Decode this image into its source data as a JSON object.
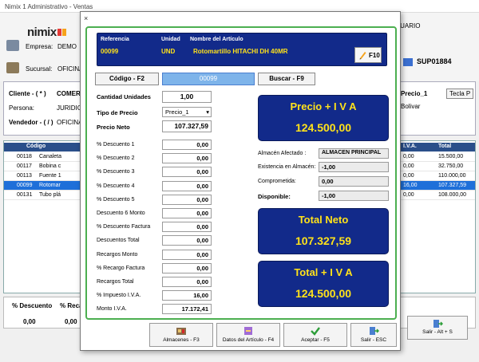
{
  "window": {
    "title": "Nimix 1 Administrativo - Ventas",
    "user_label": "USUARIO"
  },
  "background": {
    "logo": "nimix",
    "empresa_label": "Empresa:",
    "empresa_value": "DEMO",
    "sucursal_label": "Sucursal:",
    "sucursal_value": "OFICINA",
    "doc_number": "SUP01884",
    "cliente_label": "Cliente - ( * )",
    "cliente_value": "COMERCI",
    "persona_label": "Persona:",
    "persona_value": "JURIDICA",
    "vendedor_label": "Vendedor - ( / )",
    "vendedor_value": "OFICINA",
    "precio_label": "Precio_1",
    "tecla_label": "Tecla P",
    "city": "Bolivar",
    "grid_headers": [
      "Código",
      "I.V.A.",
      "Total"
    ],
    "grid_rows": [
      {
        "code": "00118",
        "desc": "Canaleta",
        "iva": "0,00",
        "total": "15.500,00",
        "selected": false
      },
      {
        "code": "00117",
        "desc": "Bobina c",
        "iva": "0,00",
        "total": "32.750,00",
        "selected": false
      },
      {
        "code": "00113",
        "desc": "Fuente 1",
        "iva": "0,00",
        "total": "110.000,00",
        "selected": false
      },
      {
        "code": "00099",
        "desc": "Rotomar",
        "iva": "16,00",
        "total": "107.327,59",
        "selected": true
      },
      {
        "code": "00131",
        "desc": "Tubo plá",
        "iva": "0,00",
        "total": "108.000,00",
        "selected": false
      }
    ],
    "footer_labels": [
      "% Descuento",
      "% Recar"
    ],
    "footer_values": [
      "0,00",
      "0,00"
    ],
    "salir_label": "Salir - Alt + S"
  },
  "modal": {
    "close": "×",
    "article": {
      "ref_label": "Referencia",
      "unit_label": "Unidad",
      "name_label": "Nombre del Artículo",
      "ref_value": "00099",
      "unit_value": "UND",
      "name_value": "Rotomartillo HITACHI DH 40MR",
      "f10_label": "F10"
    },
    "codigo_button": "Código - F2",
    "codigo_input": "00099",
    "buscar_button": "Buscar - F9",
    "cantidad_label": "Cantidad Unidades",
    "cantidad_value": "1,00",
    "tipo_precio_label": "Tipo de Precio",
    "tipo_precio_value": "Precio_1",
    "precio_neto_label": "Precio Neto",
    "precio_neto_value": "107.327,59",
    "lines": [
      {
        "label": "% Descuento 1",
        "value": "0,00"
      },
      {
        "label": "% Descuento 2",
        "value": "0,00"
      },
      {
        "label": "% Descuento 3",
        "value": "0,00"
      },
      {
        "label": "% Descuento 4",
        "value": "0,00"
      },
      {
        "label": "% Descuento 5",
        "value": "0,00"
      },
      {
        "label": "Descuento 6 Monto",
        "value": "0,00"
      },
      {
        "label": "% Descuento Factura",
        "value": "0,00"
      },
      {
        "label": "Descuentos Total",
        "value": "0,00"
      },
      {
        "label": "Recargos Monto",
        "value": "0,00"
      },
      {
        "label": "% Recargo Factura",
        "value": "0,00"
      },
      {
        "label": "Recargos Total",
        "value": "0,00"
      },
      {
        "label": "% Impuesto I.V.A.",
        "value": "16,00"
      },
      {
        "label": "Monto I.V.A.",
        "value": "17.172,41"
      }
    ],
    "precio_iva_title": "Precio + I V A",
    "precio_iva_value": "124.500,00",
    "almacen_label": "Almacén Afectado :",
    "almacen_value": "ALMACEN PRINCIPAL",
    "existencia_label": "Existencia en Almacén:",
    "existencia_value": "-1,00",
    "comprometida_label": "Comprometida:",
    "comprometida_value": "0,00",
    "disponible_label": "Disponible:",
    "disponible_value": "-1,00",
    "total_neto_title": "Total Neto",
    "total_neto_value": "107.327,59",
    "total_iva_title": "Total + I V A",
    "total_iva_value": "124.500,00",
    "buttons": {
      "almacenes": "Almacenes - F3",
      "datos": "Datos del Artículo - F4",
      "aceptar": "Aceptar - F5",
      "salir": "Salir - ESC"
    }
  },
  "colors": {
    "accent_blue": "#122a8a",
    "value_yellow": "#ffe21a",
    "green_border": "#4caf50",
    "selected_row": "#1e6fd9"
  }
}
